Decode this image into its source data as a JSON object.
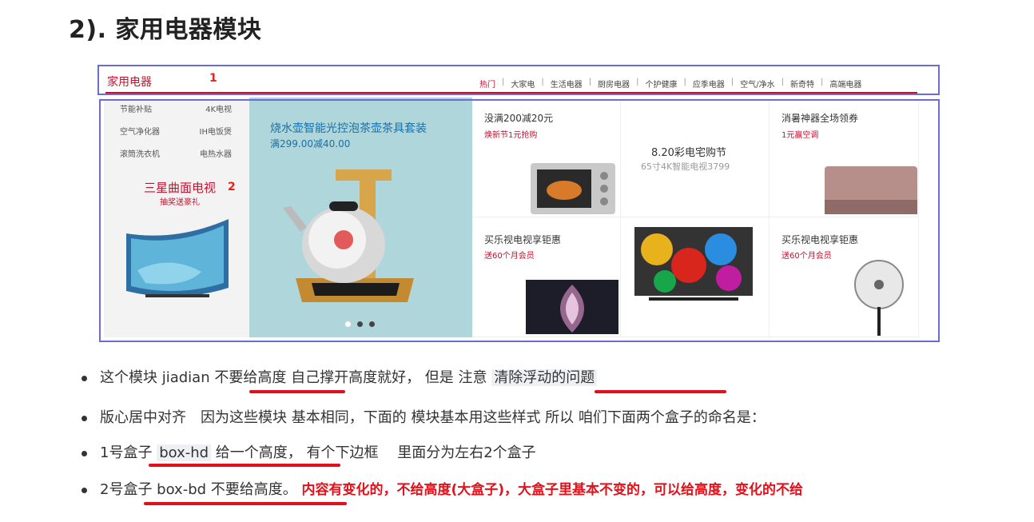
{
  "heading": "2). 家用电器模块",
  "screenshot": {
    "hd_title": "家用电器",
    "marker_1": "1",
    "marker_2": "2",
    "nav": [
      "热门",
      "大家电",
      "生活电器",
      "厨房电器",
      "个护健康",
      "应季电器",
      "空气/净水",
      "新奇特",
      "高端电器"
    ],
    "categories": [
      [
        "节能补贴",
        "4K电视"
      ],
      [
        "空气净化器",
        "IH电饭煲"
      ],
      [
        "滚筒洗衣机",
        "电热水器"
      ]
    ],
    "tv_title": "三星曲面电视",
    "tv_sub": "抽奖送豪礼",
    "mid_title": "烧水壶智能光控泡茶壶茶具套装",
    "mid_price": "满299.00减40.00",
    "cells": [
      {
        "title": "没满200减20元",
        "sub": "焕新节1元抢购"
      },
      {
        "title": "8.20彩电宅购节",
        "sub": "65寸4K智能电视3799"
      },
      {
        "title": "消暑神器全场领券",
        "sub": "1元赢空调"
      },
      {
        "title": "买乐视电视享钜惠",
        "sub": "送60个月会员"
      },
      {
        "title": "买乐视电视享钜惠",
        "sub": "送60个月会员"
      }
    ]
  },
  "bullets": {
    "b1": {
      "p1": "这个模块 jiadian ",
      "p2": "不要给高度",
      "p3": " 自己撑开高度就好， 但是 注意 ",
      "p4": "清除浮动的问题"
    },
    "b2": "版心居中对齐　因为这些模块  基本相同，下面的 模块基本用这些样式  所以 咱们下面两个盒子的命名是：",
    "b3": {
      "p1": "1号盒子 ",
      "p2": "box-hd",
      "p3": " 给一个高度，  有个下边框　   里面分为左右2个盒子"
    },
    "b4": {
      "p1": "2号盒子  box-bd  不要给高度。 ",
      "p2": "内容有变化的，不给高度(大盒子)，大盒子里基本不变的，可以给高度，变化的不给"
    }
  }
}
